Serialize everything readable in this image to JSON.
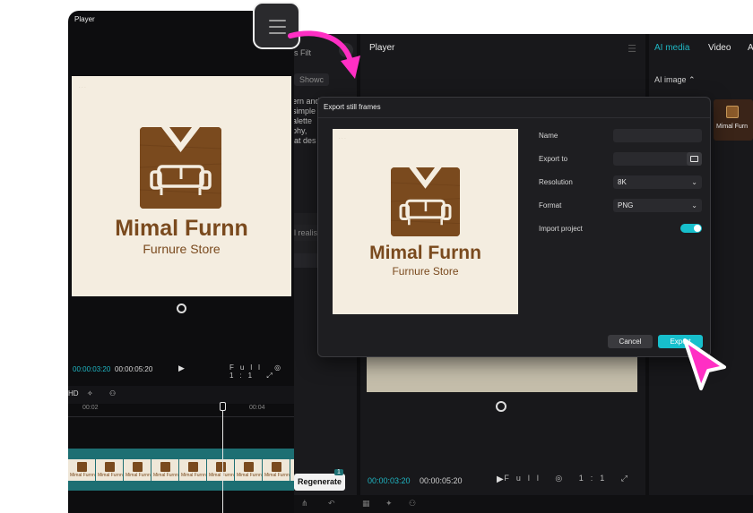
{
  "editor_bg": {
    "left_tab_fragment": "s  Filt",
    "shown_chip": "Showc",
    "prompt_text_fragment": "ern and\nsimple\nalette\nphy,\nlat des",
    "realism_fragment": "l realis",
    "player_title": "Player",
    "time_current": "00:00:03:20",
    "time_total": "00:00:05:20",
    "controls": "Full  ◎  1:1  ⤢",
    "right_tabs": [
      "AI media",
      "Video",
      "A"
    ],
    "ai_image_label": "AI image ⌃",
    "thumb_label": "Mimal Furn"
  },
  "left_panel": {
    "title": "Player",
    "time_current": "00:00:03:20",
    "time_total": "00:00:05:20",
    "controls": "Full ◎ 1:1 ⤢",
    "toolbar_hd": "HD",
    "ruler_ticks": [
      "00:02",
      "00:04"
    ],
    "frame_label": "Mimal Furnn",
    "frame_count": 8
  },
  "regenerate": {
    "label": "Regenerate",
    "badge": "1"
  },
  "logo": {
    "name": "Mimal Furnn",
    "subtitle": "Furnure Store",
    "brand_color": "#7a4a1e",
    "background": "#f4ede0"
  },
  "export_dialog": {
    "title": "Export still frames",
    "name_label": "Name",
    "name_value": "",
    "export_to_label": "Export to",
    "export_to_value": "",
    "resolution_label": "Resolution",
    "resolution_value": "8K",
    "format_label": "Format",
    "format_value": "PNG",
    "import_label": "Import project",
    "import_enabled": true,
    "cancel_label": "Cancel",
    "export_label": "Export"
  },
  "colors": {
    "accent": "#17bfcc",
    "highlight_pink": "#ff2fc4"
  },
  "icons": {
    "menu": "hamburger-icon",
    "folder": "folder-icon",
    "chevron": "chevron-down-icon",
    "play": "play-icon",
    "reset": "reset-icon",
    "cursor": "pointer-cursor-icon",
    "arrow": "curved-arrow-icon"
  }
}
